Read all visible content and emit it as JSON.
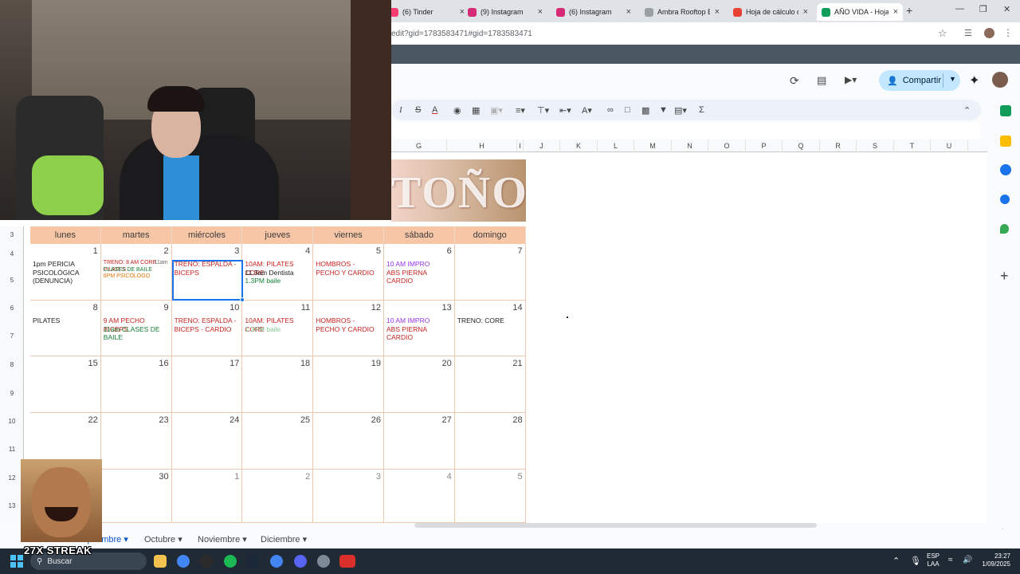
{
  "browser": {
    "tabs": [
      {
        "title": "(6) Tinder",
        "color": "#fe3c72",
        "active": false
      },
      {
        "title": "(9) Instagram",
        "color": "#d62976",
        "active": false
      },
      {
        "title": "(6) Instagram",
        "color": "#d62976",
        "active": false
      },
      {
        "title": "Ambra Rooftop B",
        "color": "#9aa0a6",
        "active": false
      },
      {
        "title": "Hoja de cálculo d",
        "color": "#ea4335",
        "active": false
      },
      {
        "title": "AÑO VIDA - Hoja",
        "color": "#0f9d58",
        "active": true
      }
    ],
    "new_tab": "+",
    "url": "edit?gid=1783583471#gid=1783583471"
  },
  "sheets": {
    "share_label": "Compartir",
    "columns": [
      "G",
      "H",
      "I",
      "J",
      "K",
      "L",
      "M",
      "N",
      "O",
      "P",
      "Q",
      "R",
      "S",
      "T",
      "U"
    ],
    "rows": [
      "3",
      "4",
      "5",
      "6",
      "7",
      "8",
      "9",
      "10",
      "11",
      "12",
      "13"
    ],
    "banner_text": "TOÑO",
    "tabs": [
      "Septiembre",
      "Octubre",
      "Noviembre",
      "Diciembre"
    ]
  },
  "calendar": {
    "days": [
      "lunes",
      "martes",
      "miércoles",
      "jueves",
      "viernes",
      "sábado",
      "domingo"
    ],
    "weeks": [
      [
        {
          "num": "1",
          "events": [
            {
              "text": "1pm PERICIA PSICOLÓGICA (DENUNCIA)",
              "color": "#202124"
            }
          ]
        },
        {
          "num": "2",
          "events": [
            {
              "text": "TRENO: 8 AM CORE PILATES",
              "color": "#c5221f",
              "small": true
            },
            {
              "text": "11am",
              "color": "#666666",
              "small": true,
              "right": true
            },
            {
              "text": "CLASES DE BAILE",
              "color": "#188038",
              "small": true
            },
            {
              "text": "6PM PSICOLOGO",
              "color": "#e37400",
              "small": true
            }
          ]
        },
        {
          "num": "3",
          "events": [
            {
              "text": "TRENO: ESPALDA - BICEPS",
              "color": "#c5221f"
            }
          ]
        },
        {
          "num": "4",
          "events": [
            {
              "text": "10AM: PILATES CORE",
              "color": "#c5221f"
            },
            {
              "text": "11.3am Dentista",
              "color": "#202124"
            },
            {
              "text": "1.3PM baile",
              "color": "#188038"
            }
          ]
        },
        {
          "num": "5",
          "events": [
            {
              "text": "HOMBROS - PECHO Y CARDIO",
              "color": "#c5221f"
            }
          ]
        },
        {
          "num": "6",
          "events": [
            {
              "text": "10 AM IMPRO",
              "color": "#9334e6"
            },
            {
              "text": "ABS PIERNA CARDIO",
              "color": "#c5221f"
            }
          ]
        },
        {
          "num": "7",
          "events": []
        }
      ],
      [
        {
          "num": "8",
          "events": [
            {
              "text": "PILATES",
              "color": "#202124"
            }
          ]
        },
        {
          "num": "9",
          "events": [
            {
              "text": "9 AM PECHO BICEPS",
              "color": "#c5221f"
            },
            {
              "text": "11am CLASES DE BAILE",
              "color": "#188038"
            }
          ]
        },
        {
          "num": "10",
          "events": [
            {
              "text": "TRENO: ESPALDA - BICEPS - CARDIO",
              "color": "#c5221f"
            }
          ]
        },
        {
          "num": "11",
          "events": [
            {
              "text": "10AM: PILATES CORE",
              "color": "#c5221f"
            },
            {
              "text": "1.3PM baile",
              "color": "#81c995"
            }
          ]
        },
        {
          "num": "12",
          "events": [
            {
              "text": "HOMBROS - PECHO Y CARDIO",
              "color": "#c5221f"
            }
          ]
        },
        {
          "num": "13",
          "events": [
            {
              "text": "10 AM IMPRO",
              "color": "#9334e6"
            },
            {
              "text": "ABS PIERNA CARDIO",
              "color": "#c5221f"
            }
          ]
        },
        {
          "num": "14",
          "events": [
            {
              "text": "TRENO: CORE",
              "color": "#202124"
            }
          ]
        }
      ],
      [
        {
          "num": "15",
          "events": []
        },
        {
          "num": "16",
          "events": []
        },
        {
          "num": "17",
          "events": []
        },
        {
          "num": "18",
          "events": []
        },
        {
          "num": "19",
          "events": []
        },
        {
          "num": "20",
          "events": []
        },
        {
          "num": "21",
          "events": []
        }
      ],
      [
        {
          "num": "22",
          "events": []
        },
        {
          "num": "23",
          "events": []
        },
        {
          "num": "24",
          "events": []
        },
        {
          "num": "25",
          "events": []
        },
        {
          "num": "26",
          "events": []
        },
        {
          "num": "27",
          "events": []
        },
        {
          "num": "28",
          "events": []
        }
      ],
      [
        {
          "num": "",
          "events": []
        },
        {
          "num": "30",
          "events": []
        },
        {
          "num": "1",
          "dim": true,
          "events": []
        },
        {
          "num": "2",
          "dim": true,
          "events": []
        },
        {
          "num": "3",
          "dim": true,
          "events": []
        },
        {
          "num": "4",
          "dim": true,
          "events": []
        },
        {
          "num": "5",
          "dim": true,
          "events": []
        }
      ]
    ]
  },
  "overlay": {
    "streak_text": "27X STREAK"
  },
  "taskbar": {
    "search_placeholder": "Buscar",
    "lang_top": "ESP",
    "lang_bottom": "LAA",
    "time": "23:27",
    "date": "1/09/2025"
  }
}
